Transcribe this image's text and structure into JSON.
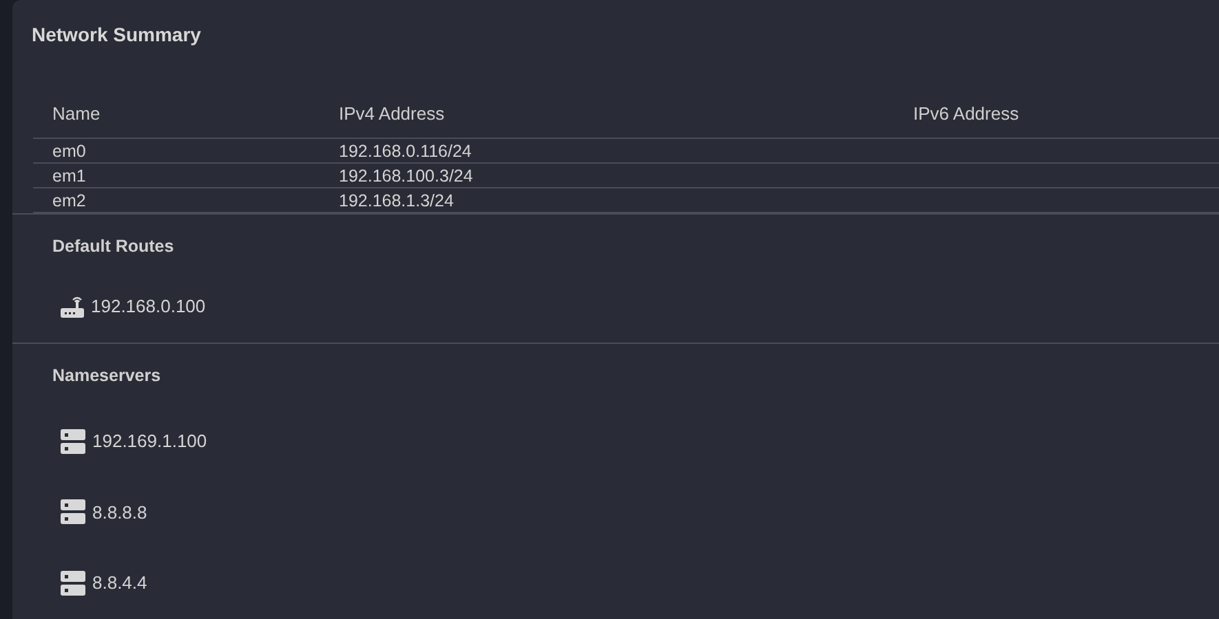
{
  "title": "Network Summary",
  "table": {
    "columns": [
      "Name",
      "IPv4 Address",
      "IPv6 Address"
    ],
    "rows": [
      [
        "em0",
        "192.168.0.116/24",
        ""
      ],
      [
        "em1",
        "192.168.100.3/24",
        ""
      ],
      [
        "em2",
        "192.168.1.3/24",
        ""
      ]
    ]
  },
  "default_routes": {
    "heading": "Default Routes",
    "items": [
      "192.168.0.100"
    ]
  },
  "nameservers": {
    "heading": "Nameservers",
    "items": [
      "192.169.1.100",
      "8.8.8.8",
      "8.8.4.4"
    ]
  }
}
